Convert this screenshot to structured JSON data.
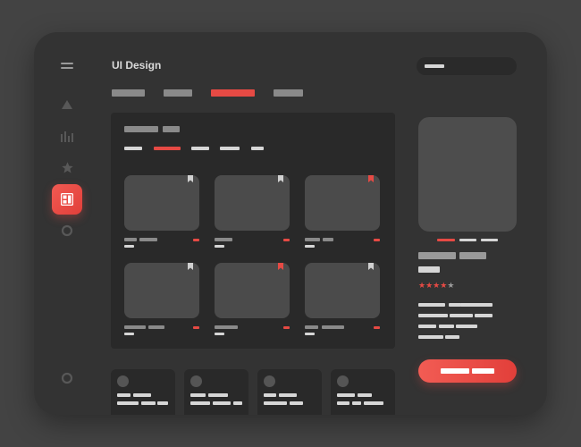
{
  "header": {
    "title": "UI Design"
  },
  "product": {
    "rating": 4,
    "max_rating": 5
  },
  "colors": {
    "accent": "#e64a44",
    "background": "#434343",
    "surface": "#333333",
    "panel": "#292929",
    "placeholder": "#8a8a8a"
  },
  "sidebar": {
    "icons": [
      "menu-icon",
      "triangle-icon",
      "bar-chart-icon",
      "star-icon",
      "dashboard-icon",
      "circle-icon",
      "settings-circle-icon"
    ],
    "active_index": 4
  }
}
